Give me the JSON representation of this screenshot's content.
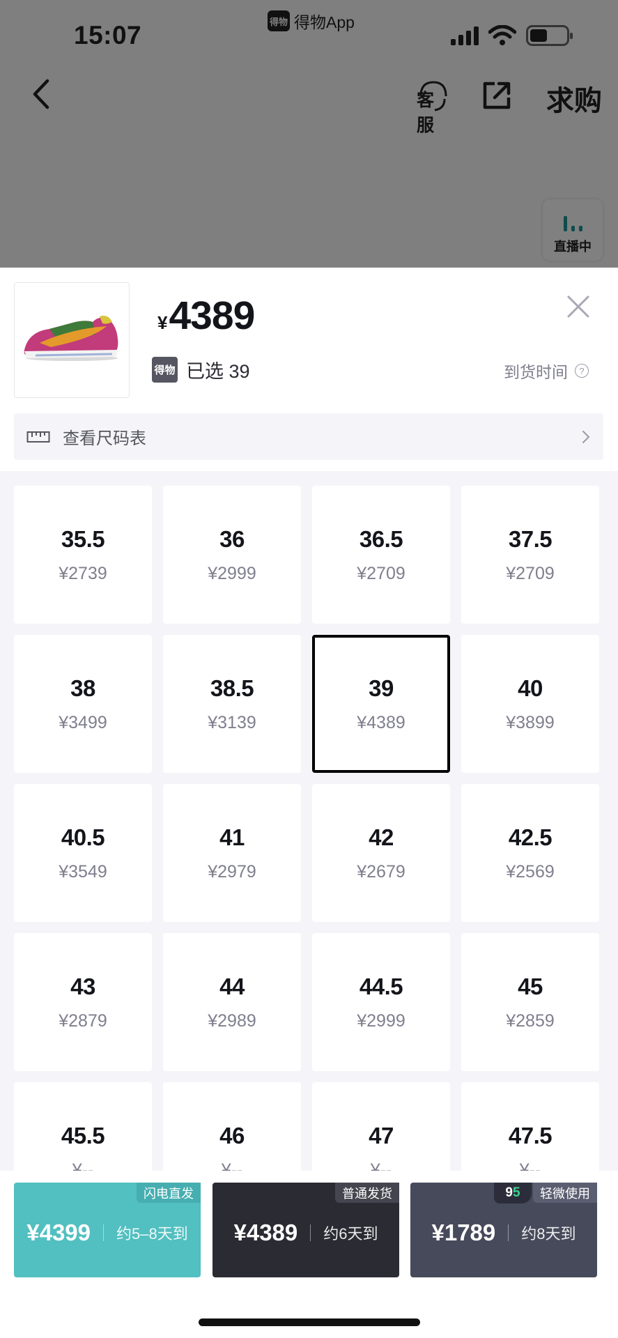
{
  "status_bar": {
    "time": "15:07",
    "app_logo": "得物",
    "app_name": "得物App"
  },
  "nav": {
    "service": "客服",
    "seek": "求购"
  },
  "live": {
    "label": "直播中"
  },
  "product": {
    "currency_symbol": "¥",
    "price": "4389",
    "platform_badge": "得物",
    "selected_text": "已选 39",
    "arrival_label": "到货时间",
    "help_icon": "?"
  },
  "size_chart": {
    "label": "查看尺码表"
  },
  "sizes": [
    {
      "size": "35.5",
      "price": "¥2739"
    },
    {
      "size": "36",
      "price": "¥2999"
    },
    {
      "size": "36.5",
      "price": "¥2709"
    },
    {
      "size": "37.5",
      "price": "¥2709"
    },
    {
      "size": "38",
      "price": "¥3499"
    },
    {
      "size": "38.5",
      "price": "¥3139"
    },
    {
      "size": "39",
      "price": "¥4389"
    },
    {
      "size": "40",
      "price": "¥3899"
    },
    {
      "size": "40.5",
      "price": "¥3549"
    },
    {
      "size": "41",
      "price": "¥2979"
    },
    {
      "size": "42",
      "price": "¥2679"
    },
    {
      "size": "42.5",
      "price": "¥2569"
    },
    {
      "size": "43",
      "price": "¥2879"
    },
    {
      "size": "44",
      "price": "¥2989"
    },
    {
      "size": "44.5",
      "price": "¥2999"
    },
    {
      "size": "45",
      "price": "¥2859"
    },
    {
      "size": "45.5",
      "price": "¥--"
    },
    {
      "size": "46",
      "price": "¥--"
    },
    {
      "size": "47",
      "price": "¥--"
    },
    {
      "size": "47.5",
      "price": "¥--"
    }
  ],
  "selected_size": "39",
  "purchase_options": [
    {
      "tag": "闪电直发",
      "price": "¥4399",
      "delivery": "约5–8天到",
      "color": "#52bfc0"
    },
    {
      "tag": "普通发货",
      "price": "¥4389",
      "delivery": "约6天到",
      "color": "#2b2b33"
    },
    {
      "tag": "轻微使用",
      "price": "¥1789",
      "delivery": "约8天到",
      "color": "#464a5a",
      "condition_9": "9",
      "condition_5": "5"
    }
  ]
}
